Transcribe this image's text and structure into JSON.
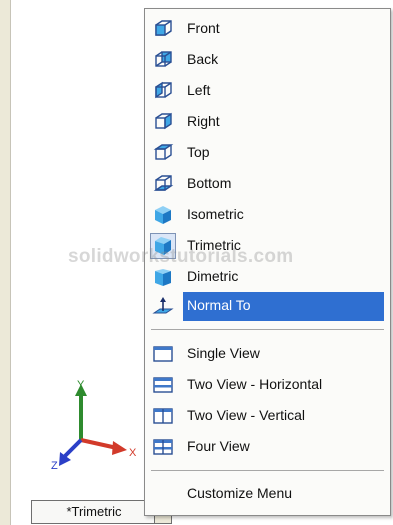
{
  "menu": {
    "view_items": [
      {
        "label": "Front",
        "icon": "front-view-icon"
      },
      {
        "label": "Back",
        "icon": "back-view-icon"
      },
      {
        "label": "Left",
        "icon": "left-view-icon"
      },
      {
        "label": "Right",
        "icon": "right-view-icon"
      },
      {
        "label": "Top",
        "icon": "top-view-icon"
      },
      {
        "label": "Bottom",
        "icon": "bottom-view-icon"
      },
      {
        "label": "Isometric",
        "icon": "isometric-view-icon"
      },
      {
        "label": "Trimetric",
        "icon": "trimetric-view-icon"
      },
      {
        "label": "Dimetric",
        "icon": "dimetric-view-icon"
      },
      {
        "label": "Normal To",
        "icon": "normal-to-icon"
      }
    ],
    "layout_items": [
      {
        "label": "Single View",
        "icon": "single-view-icon"
      },
      {
        "label": "Two View - Horizontal",
        "icon": "two-view-horizontal-icon"
      },
      {
        "label": "Two View - Vertical",
        "icon": "two-view-vertical-icon"
      },
      {
        "label": "Four View",
        "icon": "four-view-icon"
      }
    ],
    "customize_label": "Customize Menu"
  },
  "watermark": "solidworkstutorials.com",
  "triad": {
    "x": "X",
    "y": "Y",
    "z": "Z"
  },
  "view_tab": {
    "label": "*Trimetric",
    "arrow": "▸"
  },
  "colors": {
    "highlight": "#2f6fd1",
    "cube_blue": "#3fa7e6",
    "axis_x": "#d23a2a",
    "axis_y": "#2e8b2e",
    "axis_z": "#2b3fc7"
  }
}
